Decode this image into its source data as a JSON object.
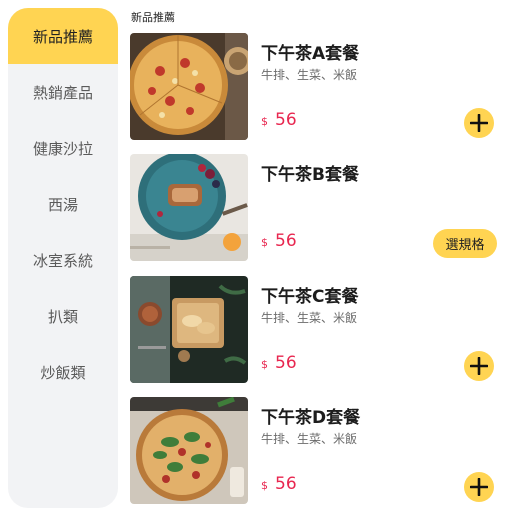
{
  "categories": [
    {
      "label": "新品推薦",
      "active": true
    },
    {
      "label": "熱銷產品"
    },
    {
      "label": "健康沙拉"
    },
    {
      "label": "西湯"
    },
    {
      "label": "冰室系統"
    },
    {
      "label": "扒類"
    },
    {
      "label": "炒飯類"
    }
  ],
  "section_title": "新品推薦",
  "products": [
    {
      "name": "下午茶A套餐",
      "desc": "牛排、生菜、米飯",
      "currency": "$",
      "price": "56",
      "action": "add",
      "image": "pizza-top-view"
    },
    {
      "name": "下午茶B套餐",
      "desc": "",
      "currency": "$",
      "price": "56",
      "action": "spec",
      "spec_label": "選規格",
      "image": "dessert-plate"
    },
    {
      "name": "下午茶C套餐",
      "desc": "牛排、生菜、米飯",
      "currency": "$",
      "price": "56",
      "action": "add",
      "image": "bread-tray"
    },
    {
      "name": "下午茶D套餐",
      "desc": "牛排、生菜、米飯",
      "currency": "$",
      "price": "56",
      "action": "add",
      "image": "basil-pizza"
    }
  ],
  "colors": {
    "accent": "#ffd452",
    "price": "#e8264f",
    "sidebar_bg": "#f2f3f5"
  }
}
